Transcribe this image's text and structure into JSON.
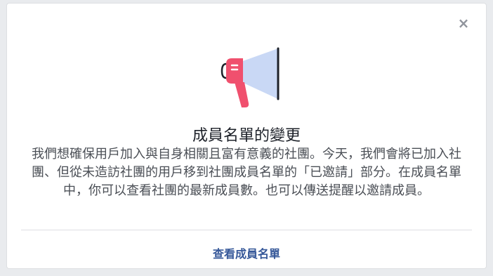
{
  "dialog": {
    "close_glyph": "×",
    "title": "成員名單的變更",
    "body": "我們想確保用戶加入與自身相關且富有意義的社團。今天，我們會將已加入社團、但從未造訪社團的用戶移到社團成員名單的「已邀請」部分。在成員名單中，你可以查看社團的最新成員數。也可以傳送提醒以邀請成員。",
    "action_label": "查看成員名單"
  },
  "colors": {
    "accent_red": "#f0506e",
    "beam_blue": "#c9d8f5",
    "link_blue": "#365899"
  },
  "icons": {
    "illustration": "megaphone-icon",
    "close": "close-icon"
  }
}
